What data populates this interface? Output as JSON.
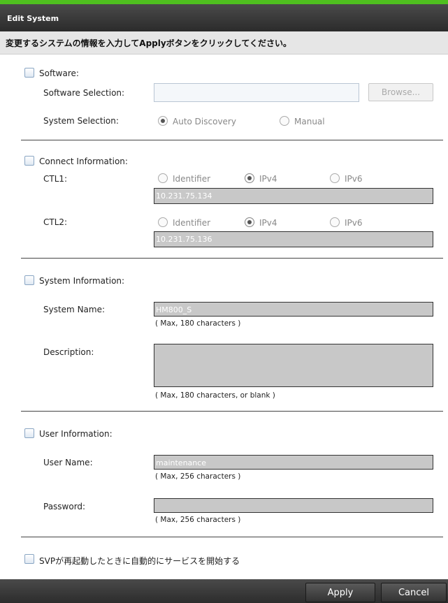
{
  "window": {
    "title": "Edit System"
  },
  "instruction": "変更するシステムの情報を入力してApplyボタンをクリックしてください。",
  "software": {
    "section_label": "Software:",
    "selection_label": "Software Selection:",
    "selection_value": "",
    "browse_label": "Browse...",
    "system_selection_label": "System Selection:",
    "options": [
      "Auto Discovery",
      "Manual"
    ],
    "selected": "Auto Discovery"
  },
  "connect": {
    "section_label": "Connect Information:",
    "ctl1": {
      "label": "CTL1:",
      "options": [
        "Identifier",
        "IPv4",
        "IPv6"
      ],
      "selected": "IPv4",
      "value": "10.231.75.134"
    },
    "ctl2": {
      "label": "CTL2:",
      "options": [
        "Identifier",
        "IPv4",
        "IPv6"
      ],
      "selected": "IPv4",
      "value": "10.231.75.136"
    }
  },
  "system_info": {
    "section_label": "System Information:",
    "name_label": "System Name:",
    "name_value": "HM800_S",
    "name_hint": "( Max, 180 characters )",
    "description_label": "Description:",
    "description_value": "",
    "description_hint": "( Max, 180 characters, or blank )"
  },
  "user_info": {
    "section_label": "User Information:",
    "username_label": "User Name:",
    "username_value": "maintenance",
    "username_hint": "( Max, 256 characters )",
    "password_label": "Password:",
    "password_value": "",
    "password_hint": "( Max, 256 characters )"
  },
  "svp_label": "SVPが再起動したときに自動的にサービスを開始する",
  "footer": {
    "apply_label": "Apply",
    "cancel_label": "Cancel"
  },
  "colors": {
    "accent": "#4fbf1f",
    "titlebar": "#2b2b2b",
    "field_disabled": "#c8c8c8"
  }
}
